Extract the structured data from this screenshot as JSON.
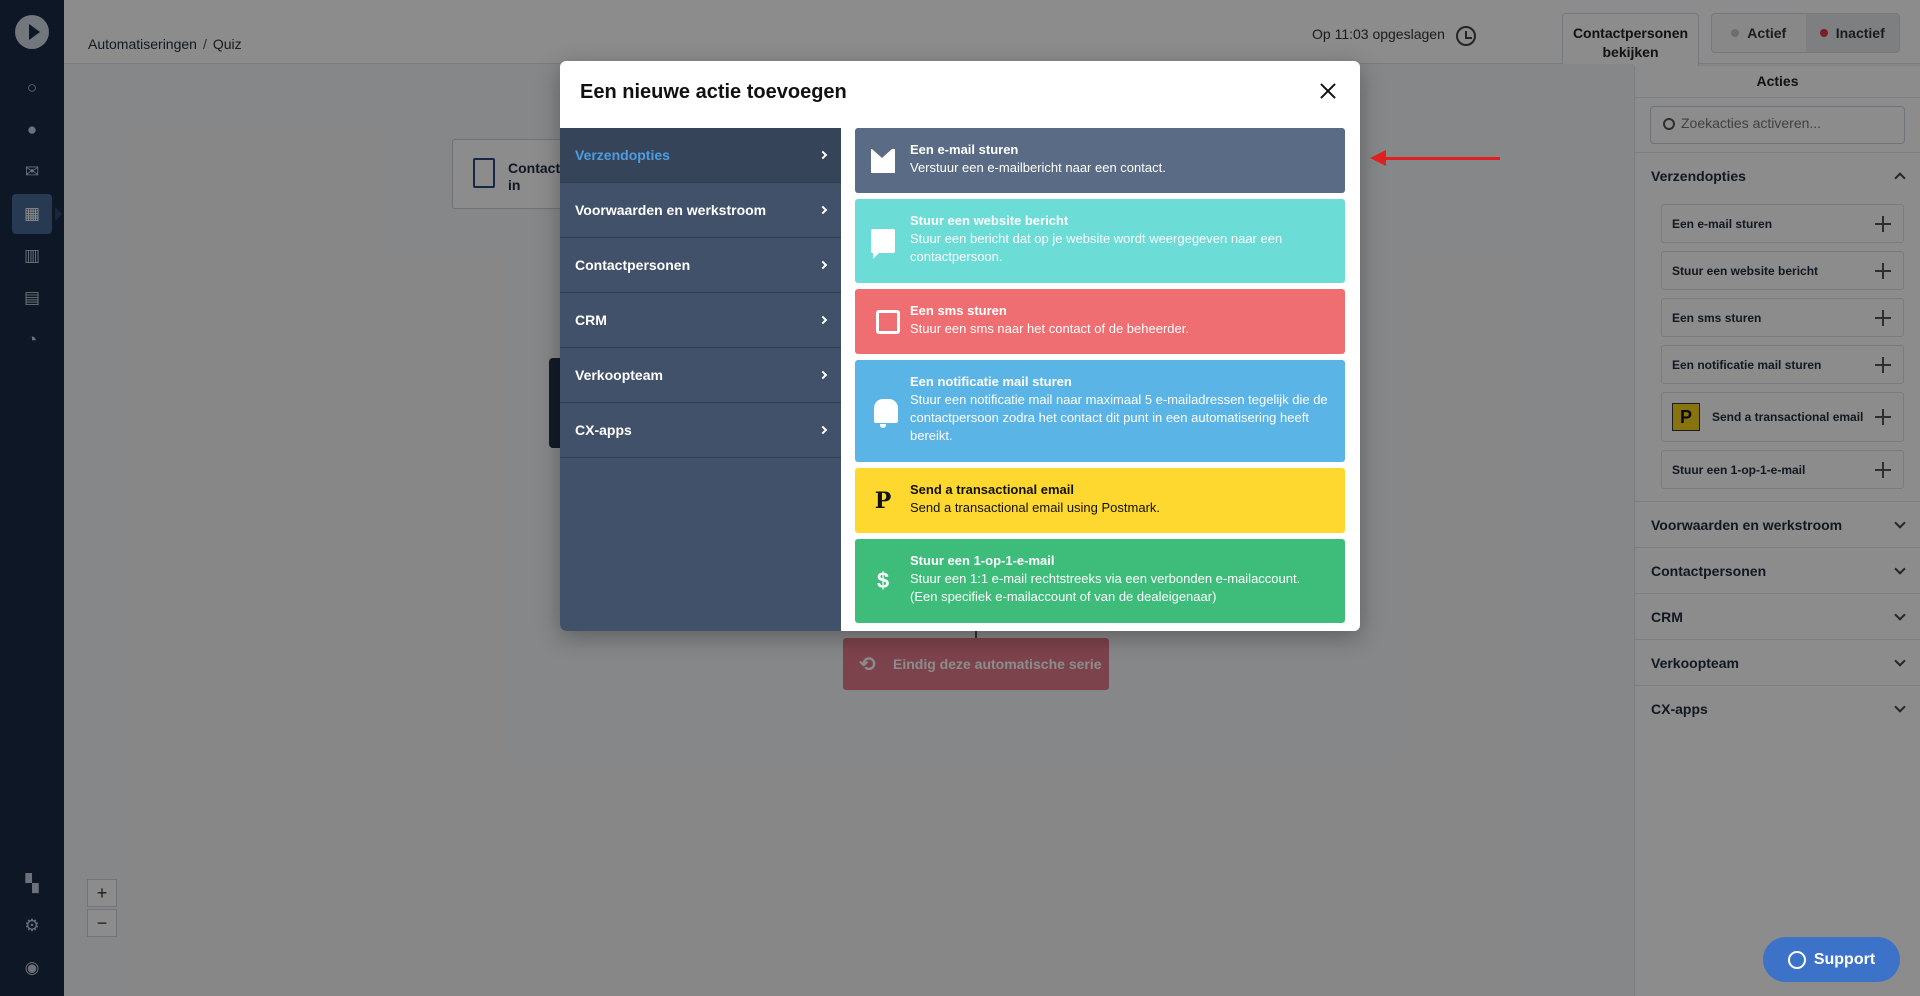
{
  "nav": {
    "icons": [
      "search-icon",
      "contacts-icon",
      "email-icon",
      "automations-icon",
      "pipeline-icon",
      "reports-icon",
      "chart-icon",
      "apps-icon",
      "gear-icon",
      "avatar-icon"
    ]
  },
  "header": {
    "breadcrumb_root": "Automatiseringen",
    "breadcrumb_sep": "/",
    "breadcrumb_current": "Quiz",
    "saved_text": "Op 11:03 opgeslagen",
    "contacts_button": "Contactpersonen bekijken",
    "status_active": "Actief",
    "status_inactive": "Inactief"
  },
  "canvas": {
    "start_node_label": "Contact\nin",
    "end_node_label": "Eindig deze automatische serie",
    "zoom_in": "+",
    "zoom_out": "−"
  },
  "right_panel": {
    "title": "Acties",
    "search_placeholder": "Zoekacties activeren...",
    "sections": [
      {
        "label": "Verzendopties",
        "open": true
      },
      {
        "label": "Voorwaarden en werkstroom",
        "open": false
      },
      {
        "label": "Contactpersonen",
        "open": false
      },
      {
        "label": "CRM",
        "open": false
      },
      {
        "label": "Verkoopteam",
        "open": false
      },
      {
        "label": "CX-apps",
        "open": false
      }
    ],
    "items": [
      "Een e-mail sturen",
      "Stuur een website bericht",
      "Een sms sturen",
      "Een notificatie mail sturen",
      "Send a transactional email",
      "Stuur een 1-op-1-e-mail"
    ],
    "postmark_badge": "P"
  },
  "support_button": "Support",
  "modal": {
    "title": "Een nieuwe actie toevoegen",
    "categories": [
      "Verzendopties",
      "Voorwaarden en werkstroom",
      "Contactpersonen",
      "CRM",
      "Verkoopteam",
      "CX-apps"
    ],
    "actions": [
      {
        "title": "Een e-mail sturen",
        "desc": "Verstuur een e-mailbericht naar een contact."
      },
      {
        "title": "Stuur een website bericht",
        "desc": "Stuur een bericht dat op je website wordt weergegeven naar een contactpersoon."
      },
      {
        "title": "Een sms sturen",
        "desc": "Stuur een sms naar het contact of de beheerder."
      },
      {
        "title": "Een notificatie mail sturen",
        "desc": "Stuur een notificatie mail naar maximaal 5 e-mailadressen tegelijk die de contactpersoon zodra het contact dit punt in een automatisering heeft bereikt."
      },
      {
        "title": "Send a transactional email",
        "desc": "Send a transactional email using Postmark."
      },
      {
        "title": "Stuur een 1-op-1-e-mail",
        "desc": "Stuur een 1:1 e-mail rechtstreeks via een verbonden e-mailaccount. (Een specifiek e-mailaccount of van de dealeigenaar)"
      }
    ],
    "postmark_icon_letter": "P",
    "dollar_icon_char": "$"
  },
  "colors": {
    "nav_bg": "#1a2a44",
    "modal_nav_bg": "#415169",
    "active_category": "#4d9de0",
    "email_card": "#5a6b85",
    "web_card": "#6cdcd7",
    "sms_card": "#ef6e71",
    "notif_card": "#5ab5e6",
    "postmark_card": "#fed82f",
    "one_to_one_card": "#3ebd7a",
    "annotation_arrow": "#e02020"
  }
}
